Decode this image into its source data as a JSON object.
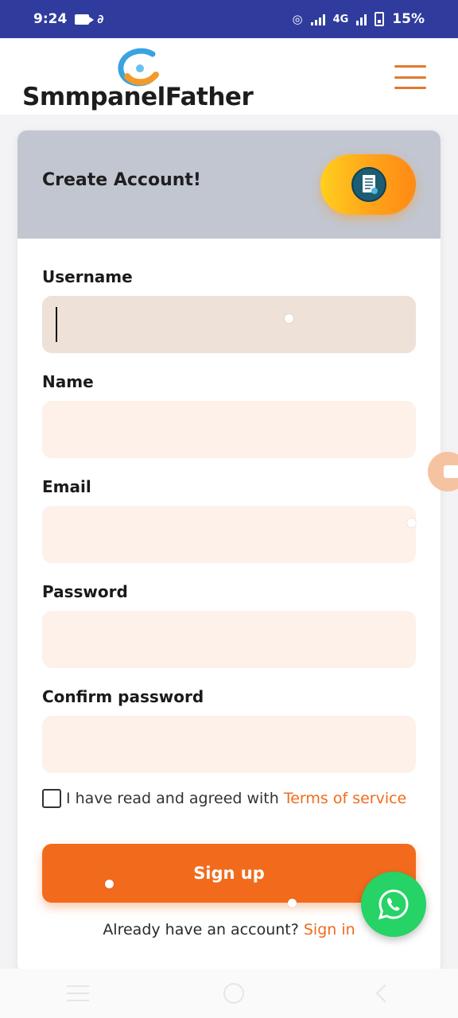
{
  "status_bar": {
    "time": "9:24",
    "network": "4G",
    "battery": "15%"
  },
  "header": {
    "brand": "SmmpanelFather",
    "accent": "#e07a2e"
  },
  "card": {
    "title": "Create Account!"
  },
  "form": {
    "fields": [
      {
        "label": "Username",
        "value": "",
        "placeholder": ""
      },
      {
        "label": "Name",
        "value": "",
        "placeholder": ""
      },
      {
        "label": "Email",
        "value": "",
        "placeholder": ""
      },
      {
        "label": "Password",
        "value": "",
        "placeholder": ""
      },
      {
        "label": "Confirm password",
        "value": "",
        "placeholder": ""
      }
    ],
    "terms_text": "I have read and agreed with ",
    "terms_link": "Terms of service",
    "terms_checked": false,
    "signup_label": "Sign up",
    "already_text": "Already have an account? ",
    "signin_link": "Sign in"
  },
  "colors": {
    "status_bar": "#2f3c9d",
    "primary": "#f26b1d",
    "input_bg": "#fdf1ea",
    "card_header": "#c1c6d0",
    "whatsapp": "#25d366"
  },
  "icons": {
    "whatsapp": "whatsapp-icon",
    "document": "document-icon",
    "menu": "hamburger-menu-icon"
  }
}
